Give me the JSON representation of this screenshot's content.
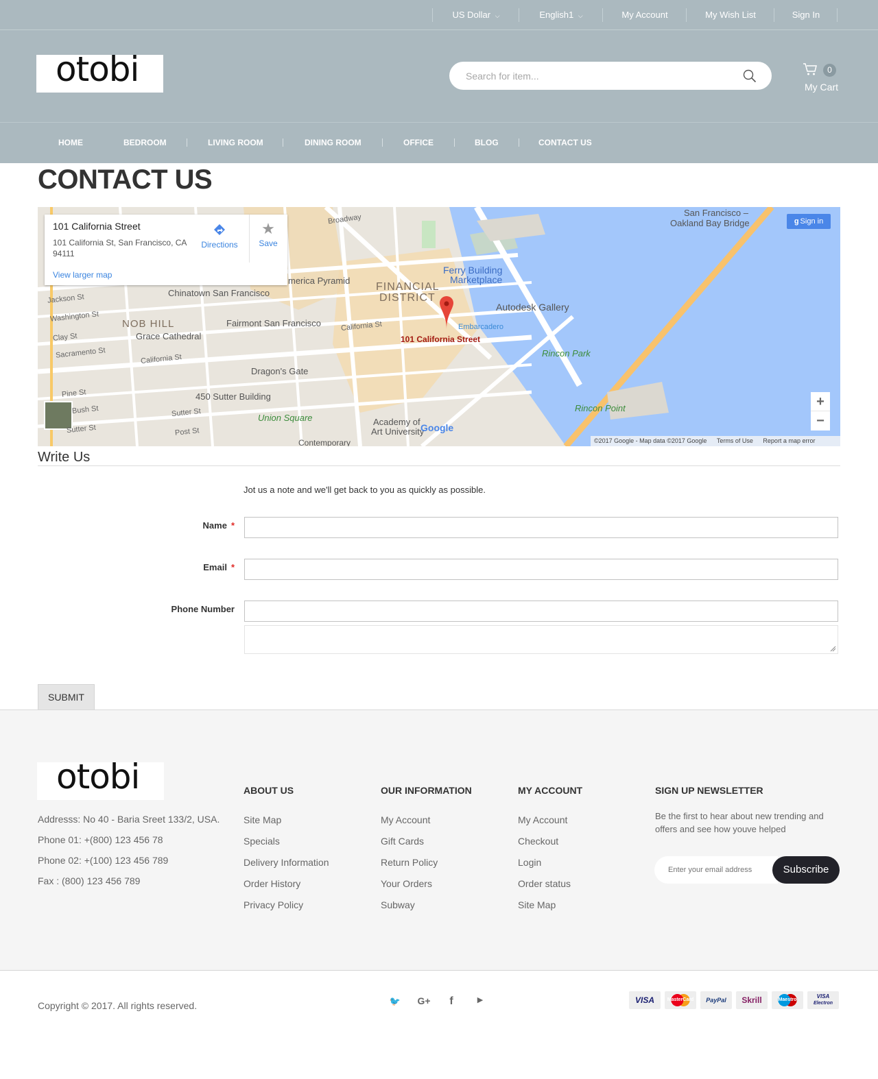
{
  "topbar": {
    "currency": "US Dollar",
    "language": "English1",
    "my_account": "My Account",
    "wish_list": "My Wish List",
    "sign_in": "Sign In"
  },
  "header": {
    "logo_text": "otobi",
    "search_placeholder": "Search for item...",
    "cart_count": "0",
    "cart_label": "My Cart"
  },
  "nav": {
    "items": [
      "Home",
      "Bedroom",
      "Living Room",
      "Dining Room",
      "Office",
      "Blog",
      "Contact Us"
    ]
  },
  "page": {
    "title": "CONTACT US"
  },
  "map": {
    "place_name": "101 California Street",
    "address_line1": "101 California St, San Francisco, CA",
    "address_line2": "94111",
    "directions": "Directions",
    "save": "Save",
    "larger_map": "View larger map",
    "sign_in": "Sign in",
    "marker_label": "101 California Street",
    "attribution": "©2017 Google - Map data ©2017 Google",
    "terms": "Terms of Use",
    "report": "Report a map error",
    "zoom_in": "+",
    "zoom_out": "−",
    "labels": {
      "financial": "FINANCIAL",
      "district": "DISTRICT",
      "nob_hill": "NOB HILL",
      "chinatown": "Chinatown San Francisco",
      "pyramid": "merica Pyramid",
      "ferry1": "Ferry Building",
      "ferry2": "Marketplace",
      "autodesk": "Autodesk Gallery",
      "fairmont": "Fairmont San Francisco",
      "grace": "Grace Cathedral",
      "dragon": "Dragon's Gate",
      "sutter450": "450 Sutter Building",
      "union": "Union Square",
      "academy1": "Academy of",
      "academy2": "Art University",
      "rincon_park": "Rincon Park",
      "rincon_point": "Rincon Point",
      "bay_bridge1": "San Francisco –",
      "bay_bridge2": "Oakland Bay Bridge",
      "embarcadero": "Embarcadero",
      "broadway": "Broadway",
      "jackson": "Jackson St",
      "washington": "Washington St",
      "clay": "Clay St",
      "sacramento": "Sacramento St",
      "california1": "California St",
      "california2": "California St",
      "pine": "Pine St",
      "bush": "Bush St",
      "sutter": "Sutter St",
      "sutter2": "Sutter St",
      "post": "Post St",
      "contemporary": "Contemporary",
      "google": "Google"
    }
  },
  "form": {
    "section_title": "Write Us",
    "note": "Jot us a note and we'll get back to you as quickly as possible.",
    "name_label": "Name",
    "email_label": "Email",
    "phone_label": "Phone Number",
    "required_mark": "*",
    "submit": "SUBMIT"
  },
  "footer": {
    "address": "Addresss: No 40 - Baria Sreet 133/2, USA.",
    "phone1": "Phone 01: +(800) 123 456 78",
    "phone2": "Phone 02: +(100) 123 456 789",
    "fax": "Fax : (800) 123 456 789",
    "about": {
      "title": "About Us",
      "links": [
        "Site Map",
        "Specials",
        "Delivery Information",
        "Order History",
        "Privacy Policy"
      ]
    },
    "info": {
      "title": "Our Information",
      "links": [
        "My Account",
        "Gift Cards",
        "Return Policy",
        "Your Orders",
        "Subway"
      ]
    },
    "account": {
      "title": "My Account",
      "links": [
        "My Account",
        "Checkout",
        "Login",
        "Order status",
        "Site Map"
      ]
    },
    "newsletter": {
      "title": "Sign Up Newsletter",
      "text1": "Be the first to hear about new trending and",
      "text2": "offers and see how youve helped",
      "placeholder": "Enter your email address",
      "button": "Subscribe"
    },
    "copyright": "Copyright © 2017. All rights reserved.",
    "social_icons": [
      "twitter-icon",
      "google-plus-icon",
      "facebook-icon",
      "youtube-icon"
    ],
    "social_glyphs": {
      "twitter": "🐦",
      "gplus": "G+",
      "facebook": "f",
      "youtube": "▶"
    },
    "payments": {
      "visa": "VISA",
      "mastercard": "MasterCard",
      "paypal": "PayPal",
      "skrill": "Skrill",
      "maestro": "Maestro",
      "electron1": "VISA",
      "electron2": "Electron"
    }
  },
  "colors": {
    "header_bg": "#abb9bf",
    "footer_bg": "#f5f5f5",
    "required": "#e02b27",
    "subscribe_bg": "#222229",
    "map_water": "#a3c7fb",
    "map_marker": "#e64538"
  }
}
